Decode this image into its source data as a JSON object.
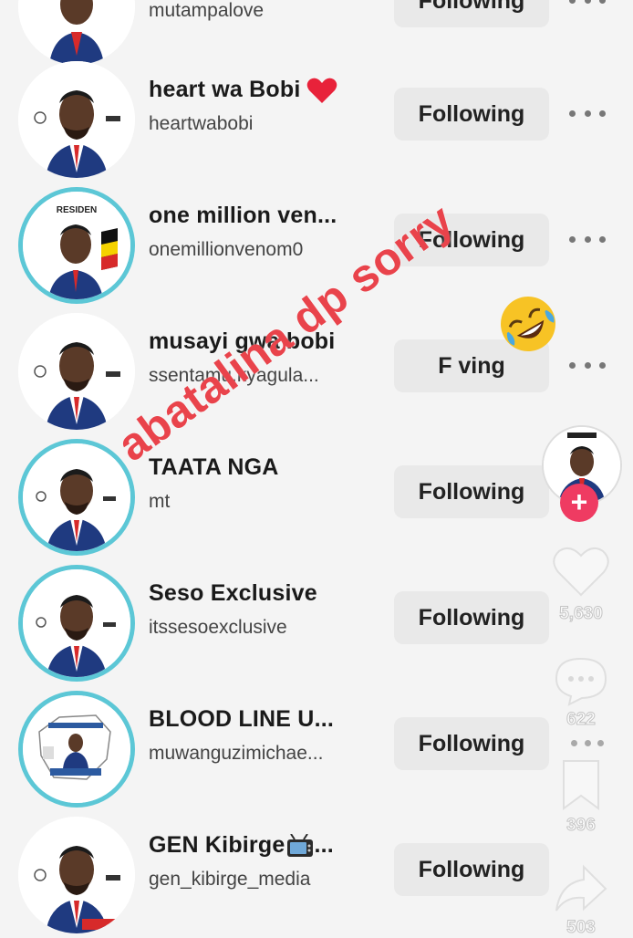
{
  "colors": {
    "follow_bg": "#e9e9e9",
    "ring": "#5cc7d6",
    "overlay_text": "#e9434b",
    "plus_button": "#ef3b62",
    "heart_emoji": "#e8223a"
  },
  "rows": [
    {
      "name": "",
      "handle": "mutampalove",
      "button": "Following",
      "ring": false
    },
    {
      "name": "heart wa Bobi",
      "handle": "heartwabobi",
      "button": "Following",
      "ring": false,
      "emoji": "red-heart"
    },
    {
      "name": "one million ven...",
      "handle": "onemillionvenom0",
      "button": "Following",
      "ring": true
    },
    {
      "name": "musayi gwa bobi",
      "handle": "ssentamu.kyagula...",
      "button": "F    ving",
      "ring": false
    },
    {
      "name": "TAATA     NGA",
      "handle": "mt",
      "button": "Following",
      "ring": true
    },
    {
      "name": "Seso Exclusive",
      "handle": "itssesoexclusive",
      "button": "Following",
      "ring": true
    },
    {
      "name": "BLOOD LINE U...",
      "handle": "muwanguzimichae...",
      "button": "Following",
      "ring": true
    },
    {
      "name": "GEN Kibirge",
      "handle": "gen_kibirge_media",
      "button": "Following",
      "ring": false,
      "emoji": "tv",
      "suffix": "..."
    }
  ],
  "overlay": {
    "text": "abatalina dp sorry",
    "emoji": "rolling-on-floor-laughing"
  },
  "rail": {
    "like_count": "5,630",
    "comment_count": "622",
    "save_count": "396",
    "share_count": "503",
    "icons": [
      "heart-icon",
      "comment-icon",
      "bookmark-icon",
      "share-icon"
    ]
  }
}
